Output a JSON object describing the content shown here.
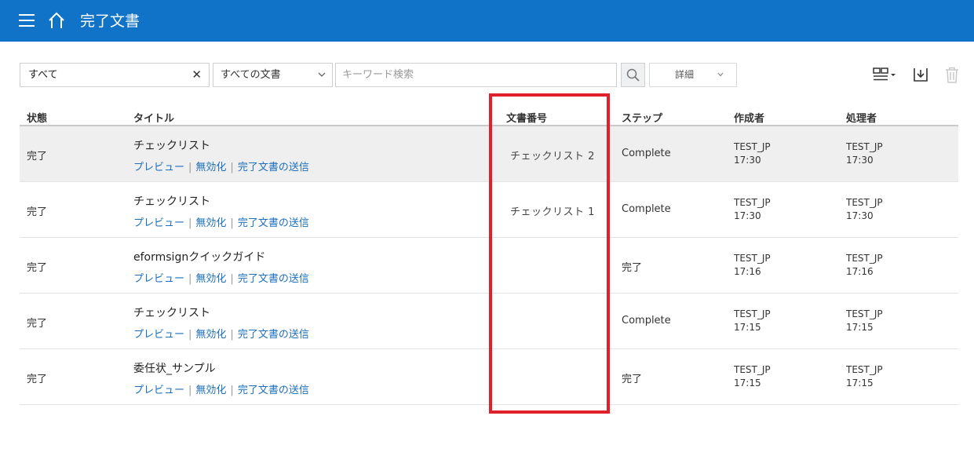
{
  "header": {
    "title": "完了文書"
  },
  "filters": {
    "status_value": "すべて",
    "clear_symbol": "✕",
    "doc_type_value": "すべての文書",
    "keyword_placeholder": "キーワード検索",
    "detail_label": "詳細"
  },
  "table": {
    "columns": {
      "state": "状態",
      "title": "タイトル",
      "doc_number": "文書番号",
      "step": "ステップ",
      "creator": "作成者",
      "handler": "処理者"
    },
    "links": {
      "preview": "プレビュー",
      "disable": "無効化",
      "send": "完了文書の送信",
      "separator": "|"
    },
    "rows": [
      {
        "state": "完了",
        "title": "チェックリスト",
        "doc_number": "チェックリスト 2",
        "step": "Complete",
        "creator": "TEST_JP",
        "creator_time": "17:30",
        "handler": "TEST_JP",
        "handler_time": "17:30"
      },
      {
        "state": "完了",
        "title": "チェックリスト",
        "doc_number": "チェックリスト 1",
        "step": "Complete",
        "creator": "TEST_JP",
        "creator_time": "17:30",
        "handler": "TEST_JP",
        "handler_time": "17:30"
      },
      {
        "state": "完了",
        "title": "eformsignクイックガイド",
        "doc_number": "",
        "step": "完了",
        "creator": "TEST_JP",
        "creator_time": "17:16",
        "handler": "TEST_JP",
        "handler_time": "17:16"
      },
      {
        "state": "完了",
        "title": "チェックリスト",
        "doc_number": "",
        "step": "Complete",
        "creator": "TEST_JP",
        "creator_time": "17:15",
        "handler": "TEST_JP",
        "handler_time": "17:15"
      },
      {
        "state": "完了",
        "title": "委任状_サンプル",
        "doc_number": "",
        "step": "完了",
        "creator": "TEST_JP",
        "creator_time": "17:15",
        "handler": "TEST_JP",
        "handler_time": "17:15"
      }
    ]
  },
  "colors": {
    "header_bg": "#1173c7",
    "link": "#1d6fbd",
    "highlight": "#e0202a",
    "selected_row": "#efefef"
  }
}
